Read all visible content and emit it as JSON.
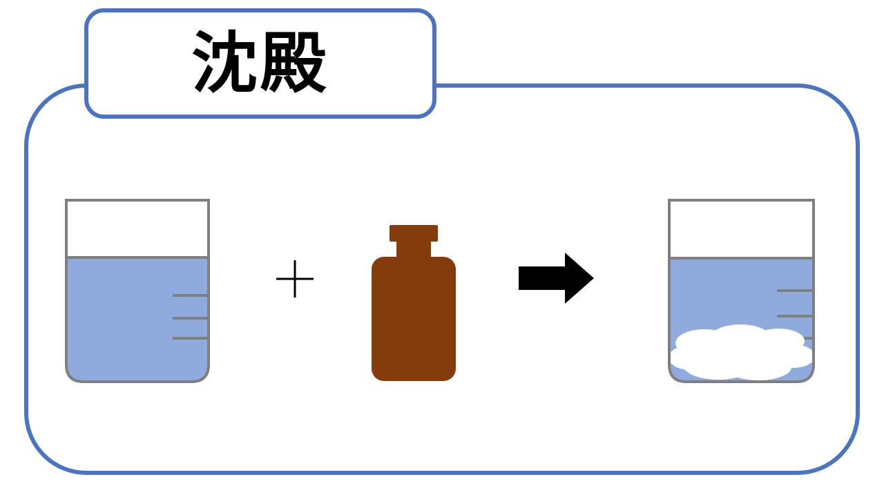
{
  "title": "沈殿",
  "colors": {
    "frame_border": "#4a73c1",
    "beaker_outline": "#7f7f7f",
    "liquid": "#8faadc",
    "reagent_bottle": "#843c0c",
    "precipitate": "#ffffff",
    "arrow": "#000000"
  },
  "icons": {
    "left_beaker": "beaker-with-solution",
    "plus": "plus-icon",
    "bottle": "reagent-bottle-icon",
    "arrow": "right-arrow-icon",
    "right_beaker": "beaker-with-precipitate"
  }
}
